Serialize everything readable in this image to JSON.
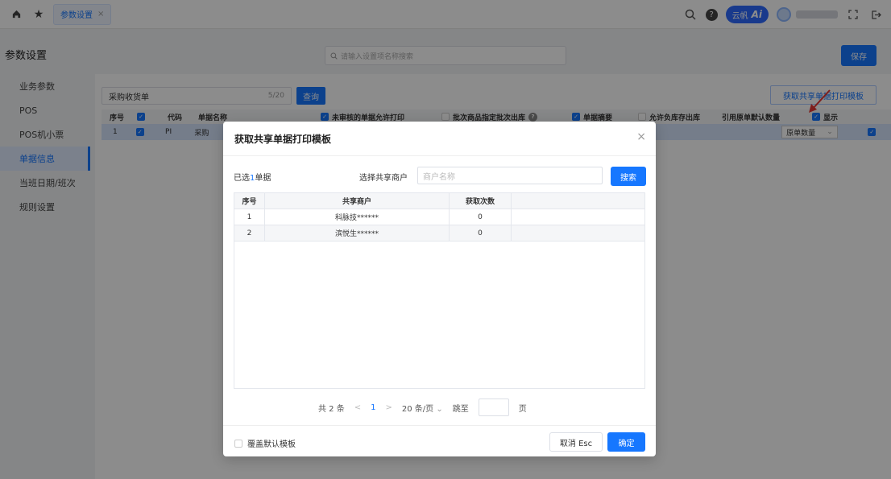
{
  "topbar": {
    "tab_label": "参数设置",
    "tab_close": "×",
    "ai_label": "云帆",
    "ai_mark": "Ai"
  },
  "header": {
    "page_title": "参数设置",
    "search_placeholder": "请输入设置项名称搜索",
    "save_label": "保存"
  },
  "sidebar": {
    "items": [
      {
        "label": "业务参数"
      },
      {
        "label": "POS"
      },
      {
        "label": "POS机小票"
      },
      {
        "label": "单据信息"
      },
      {
        "label": "当班日期/班次"
      },
      {
        "label": "规则设置"
      }
    ],
    "active_index": 3
  },
  "toolbar": {
    "doc_input_value": "采购收货单",
    "doc_input_count": "5/20",
    "query_label": "查询",
    "get_template_label": "获取共享单据打印模板"
  },
  "grid": {
    "headers": [
      "序号",
      "",
      "代码",
      "单据名称",
      "未审核的单据允许打印",
      "批次商品指定批次出库",
      "单据摘要",
      "允许负库存出库",
      "引用原单默认数量",
      "显示"
    ],
    "row": {
      "seq": "1",
      "code": "PI",
      "name": "采购",
      "ref_qty": "原单数量"
    }
  },
  "modal": {
    "title": "获取共享单据打印模板",
    "close": "×",
    "selected_prefix": "已选",
    "selected_count": "1",
    "selected_suffix": "单据",
    "share_label": "选择共享商户",
    "share_placeholder": "商户名称",
    "search_label": "搜索",
    "columns": [
      "序号",
      "共享商户",
      "获取次数"
    ],
    "rows": [
      {
        "seq": "1",
        "merchant": "科脉技******",
        "count": "0"
      },
      {
        "seq": "2",
        "merchant": "滨悦生******",
        "count": "0"
      }
    ],
    "pager": {
      "total": "共 2 条",
      "prev": "<",
      "page": "1",
      "next": ">",
      "page_size": "20 条/页",
      "jump_label": "跳至",
      "page_unit": "页"
    },
    "cover_label": "覆盖默认模板",
    "cancel_label": "取消 Esc",
    "ok_label": "确定"
  },
  "colors": {
    "primary": "#1677ff",
    "arrow": "#e53935"
  }
}
